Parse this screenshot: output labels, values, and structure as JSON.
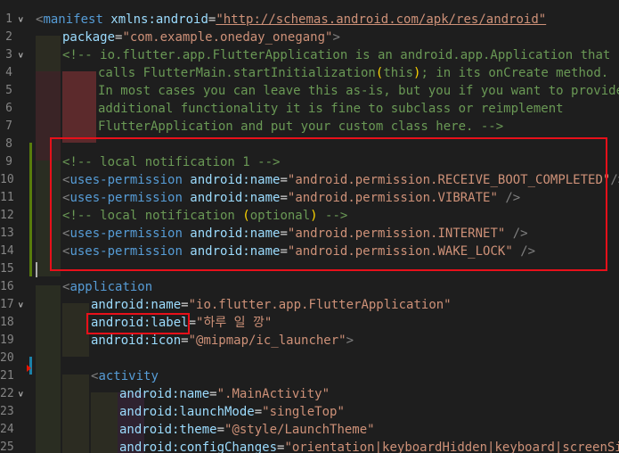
{
  "editor": {
    "line_numbers": [
      "1",
      "2",
      "3",
      "4",
      "5",
      "6",
      "7",
      "8",
      "9",
      "10",
      "11",
      "12",
      "13",
      "14",
      "15",
      "16",
      "17",
      "18",
      "19",
      "20",
      "21",
      "22",
      "23",
      "24",
      "25"
    ],
    "lines": {
      "l1": {
        "t1": "<",
        "t2": "manifest",
        "t3": " xmlns:android",
        "t4": "=",
        "t5": "\"http://schemas.android.com/apk/res/android\""
      },
      "l2": {
        "t1": "package",
        "t2": "=",
        "t3": "\"com.example.oneday_onegang\"",
        "t4": ">"
      },
      "l3": {
        "t1": "<!-- io.flutter.app.FlutterApplication is an android.app.Application that"
      },
      "l4": {
        "t1": "calls FlutterMain.startInitialization",
        "t2": "(",
        "t3": "this",
        "t4": ")",
        "t5": "; in its onCreate method."
      },
      "l5": {
        "t1": "In most cases you can leave this as-is, but you if you want to provide"
      },
      "l6": {
        "t1": "additional functionality it is fine to subclass or reimplement"
      },
      "l7": {
        "t1": "FlutterApplication and put your custom class here. -->"
      },
      "l9": {
        "t1": "<!-- local notification 1 -->"
      },
      "l10": {
        "t1": "<",
        "t2": "uses-permission",
        "t3": " android:name",
        "t4": "=",
        "t5": "\"android.permission.RECEIVE_BOOT_COMPLETED\"",
        "t6": "/>"
      },
      "l11": {
        "t1": "<",
        "t2": "uses-permission",
        "t3": " android:name",
        "t4": "=",
        "t5": "\"android.permission.VIBRATE\"",
        "t6": " />"
      },
      "l12": {
        "t1": "<!-- local notification ",
        "t2": "(",
        "t3": "optional",
        "t4": ")",
        "t5": " -->"
      },
      "l13": {
        "t1": "<",
        "t2": "uses-permission",
        "t3": " android:name",
        "t4": "=",
        "t5": "\"android.permission.INTERNET\"",
        "t6": " />"
      },
      "l14": {
        "t1": "<",
        "t2": "uses-permission",
        "t3": " android:name",
        "t4": "=",
        "t5": "\"android.permission.WAKE_LOCK\"",
        "t6": " />"
      },
      "l16": {
        "t1": "<",
        "t2": "application"
      },
      "l17": {
        "t1": "android:name",
        "t2": "=",
        "t3": "\"io.flutter.app.FlutterApplication\""
      },
      "l18": {
        "t1": "android:label",
        "t2": "=",
        "t3": "\"하루 일 깡\""
      },
      "l19": {
        "t1": "android:icon",
        "t2": "=",
        "t3": "\"@mipmap/ic_launcher\"",
        "t4": ">"
      },
      "l21": {
        "t1": "<",
        "t2": "activity"
      },
      "l22": {
        "t1": "android:name",
        "t2": "=",
        "t3": "\".MainActivity\""
      },
      "l23": {
        "t1": "android:launchMode",
        "t2": "=",
        "t3": "\"singleTop\""
      },
      "l24": {
        "t1": "android:theme",
        "t2": "=",
        "t3": "\"@style/LaunchTheme\""
      },
      "l25": {
        "t1": "android:configChanges",
        "t2": "=",
        "t3": "\"orientation|keyboardHidden|keyboard|screenSize|"
      }
    },
    "colors": {
      "background": "#1e1e1e",
      "tag": "#569cd6",
      "attribute": "#9cdcfe",
      "string": "#ce9178",
      "comment": "#6a9955",
      "highlight_box": "#e8101a",
      "added_bar": "#587c0c",
      "modified_bar": "#1b81a8"
    }
  }
}
